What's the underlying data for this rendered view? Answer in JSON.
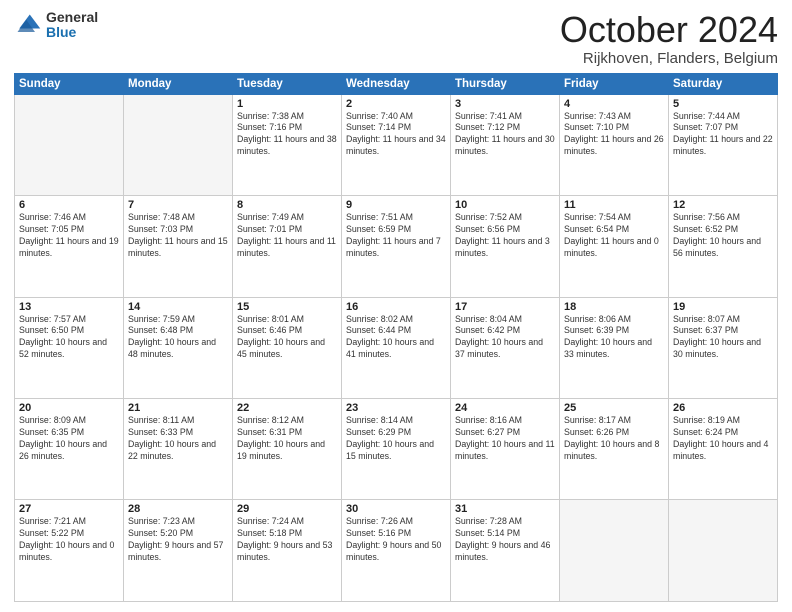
{
  "header": {
    "logo_general": "General",
    "logo_blue": "Blue",
    "title": "October 2024",
    "location": "Rijkhoven, Flanders, Belgium"
  },
  "weekdays": [
    "Sunday",
    "Monday",
    "Tuesday",
    "Wednesday",
    "Thursday",
    "Friday",
    "Saturday"
  ],
  "weeks": [
    [
      {
        "day": "",
        "sunrise": "",
        "sunset": "",
        "daylight": "",
        "empty": true
      },
      {
        "day": "",
        "sunrise": "",
        "sunset": "",
        "daylight": "",
        "empty": true
      },
      {
        "day": "1",
        "sunrise": "Sunrise: 7:38 AM",
        "sunset": "Sunset: 7:16 PM",
        "daylight": "Daylight: 11 hours and 38 minutes.",
        "empty": false
      },
      {
        "day": "2",
        "sunrise": "Sunrise: 7:40 AM",
        "sunset": "Sunset: 7:14 PM",
        "daylight": "Daylight: 11 hours and 34 minutes.",
        "empty": false
      },
      {
        "day": "3",
        "sunrise": "Sunrise: 7:41 AM",
        "sunset": "Sunset: 7:12 PM",
        "daylight": "Daylight: 11 hours and 30 minutes.",
        "empty": false
      },
      {
        "day": "4",
        "sunrise": "Sunrise: 7:43 AM",
        "sunset": "Sunset: 7:10 PM",
        "daylight": "Daylight: 11 hours and 26 minutes.",
        "empty": false
      },
      {
        "day": "5",
        "sunrise": "Sunrise: 7:44 AM",
        "sunset": "Sunset: 7:07 PM",
        "daylight": "Daylight: 11 hours and 22 minutes.",
        "empty": false
      }
    ],
    [
      {
        "day": "6",
        "sunrise": "Sunrise: 7:46 AM",
        "sunset": "Sunset: 7:05 PM",
        "daylight": "Daylight: 11 hours and 19 minutes.",
        "empty": false
      },
      {
        "day": "7",
        "sunrise": "Sunrise: 7:48 AM",
        "sunset": "Sunset: 7:03 PM",
        "daylight": "Daylight: 11 hours and 15 minutes.",
        "empty": false
      },
      {
        "day": "8",
        "sunrise": "Sunrise: 7:49 AM",
        "sunset": "Sunset: 7:01 PM",
        "daylight": "Daylight: 11 hours and 11 minutes.",
        "empty": false
      },
      {
        "day": "9",
        "sunrise": "Sunrise: 7:51 AM",
        "sunset": "Sunset: 6:59 PM",
        "daylight": "Daylight: 11 hours and 7 minutes.",
        "empty": false
      },
      {
        "day": "10",
        "sunrise": "Sunrise: 7:52 AM",
        "sunset": "Sunset: 6:56 PM",
        "daylight": "Daylight: 11 hours and 3 minutes.",
        "empty": false
      },
      {
        "day": "11",
        "sunrise": "Sunrise: 7:54 AM",
        "sunset": "Sunset: 6:54 PM",
        "daylight": "Daylight: 11 hours and 0 minutes.",
        "empty": false
      },
      {
        "day": "12",
        "sunrise": "Sunrise: 7:56 AM",
        "sunset": "Sunset: 6:52 PM",
        "daylight": "Daylight: 10 hours and 56 minutes.",
        "empty": false
      }
    ],
    [
      {
        "day": "13",
        "sunrise": "Sunrise: 7:57 AM",
        "sunset": "Sunset: 6:50 PM",
        "daylight": "Daylight: 10 hours and 52 minutes.",
        "empty": false
      },
      {
        "day": "14",
        "sunrise": "Sunrise: 7:59 AM",
        "sunset": "Sunset: 6:48 PM",
        "daylight": "Daylight: 10 hours and 48 minutes.",
        "empty": false
      },
      {
        "day": "15",
        "sunrise": "Sunrise: 8:01 AM",
        "sunset": "Sunset: 6:46 PM",
        "daylight": "Daylight: 10 hours and 45 minutes.",
        "empty": false
      },
      {
        "day": "16",
        "sunrise": "Sunrise: 8:02 AM",
        "sunset": "Sunset: 6:44 PM",
        "daylight": "Daylight: 10 hours and 41 minutes.",
        "empty": false
      },
      {
        "day": "17",
        "sunrise": "Sunrise: 8:04 AM",
        "sunset": "Sunset: 6:42 PM",
        "daylight": "Daylight: 10 hours and 37 minutes.",
        "empty": false
      },
      {
        "day": "18",
        "sunrise": "Sunrise: 8:06 AM",
        "sunset": "Sunset: 6:39 PM",
        "daylight": "Daylight: 10 hours and 33 minutes.",
        "empty": false
      },
      {
        "day": "19",
        "sunrise": "Sunrise: 8:07 AM",
        "sunset": "Sunset: 6:37 PM",
        "daylight": "Daylight: 10 hours and 30 minutes.",
        "empty": false
      }
    ],
    [
      {
        "day": "20",
        "sunrise": "Sunrise: 8:09 AM",
        "sunset": "Sunset: 6:35 PM",
        "daylight": "Daylight: 10 hours and 26 minutes.",
        "empty": false
      },
      {
        "day": "21",
        "sunrise": "Sunrise: 8:11 AM",
        "sunset": "Sunset: 6:33 PM",
        "daylight": "Daylight: 10 hours and 22 minutes.",
        "empty": false
      },
      {
        "day": "22",
        "sunrise": "Sunrise: 8:12 AM",
        "sunset": "Sunset: 6:31 PM",
        "daylight": "Daylight: 10 hours and 19 minutes.",
        "empty": false
      },
      {
        "day": "23",
        "sunrise": "Sunrise: 8:14 AM",
        "sunset": "Sunset: 6:29 PM",
        "daylight": "Daylight: 10 hours and 15 minutes.",
        "empty": false
      },
      {
        "day": "24",
        "sunrise": "Sunrise: 8:16 AM",
        "sunset": "Sunset: 6:27 PM",
        "daylight": "Daylight: 10 hours and 11 minutes.",
        "empty": false
      },
      {
        "day": "25",
        "sunrise": "Sunrise: 8:17 AM",
        "sunset": "Sunset: 6:26 PM",
        "daylight": "Daylight: 10 hours and 8 minutes.",
        "empty": false
      },
      {
        "day": "26",
        "sunrise": "Sunrise: 8:19 AM",
        "sunset": "Sunset: 6:24 PM",
        "daylight": "Daylight: 10 hours and 4 minutes.",
        "empty": false
      }
    ],
    [
      {
        "day": "27",
        "sunrise": "Sunrise: 7:21 AM",
        "sunset": "Sunset: 5:22 PM",
        "daylight": "Daylight: 10 hours and 0 minutes.",
        "empty": false
      },
      {
        "day": "28",
        "sunrise": "Sunrise: 7:23 AM",
        "sunset": "Sunset: 5:20 PM",
        "daylight": "Daylight: 9 hours and 57 minutes.",
        "empty": false
      },
      {
        "day": "29",
        "sunrise": "Sunrise: 7:24 AM",
        "sunset": "Sunset: 5:18 PM",
        "daylight": "Daylight: 9 hours and 53 minutes.",
        "empty": false
      },
      {
        "day": "30",
        "sunrise": "Sunrise: 7:26 AM",
        "sunset": "Sunset: 5:16 PM",
        "daylight": "Daylight: 9 hours and 50 minutes.",
        "empty": false
      },
      {
        "day": "31",
        "sunrise": "Sunrise: 7:28 AM",
        "sunset": "Sunset: 5:14 PM",
        "daylight": "Daylight: 9 hours and 46 minutes.",
        "empty": false
      },
      {
        "day": "",
        "sunrise": "",
        "sunset": "",
        "daylight": "",
        "empty": true
      },
      {
        "day": "",
        "sunrise": "",
        "sunset": "",
        "daylight": "",
        "empty": true
      }
    ]
  ]
}
